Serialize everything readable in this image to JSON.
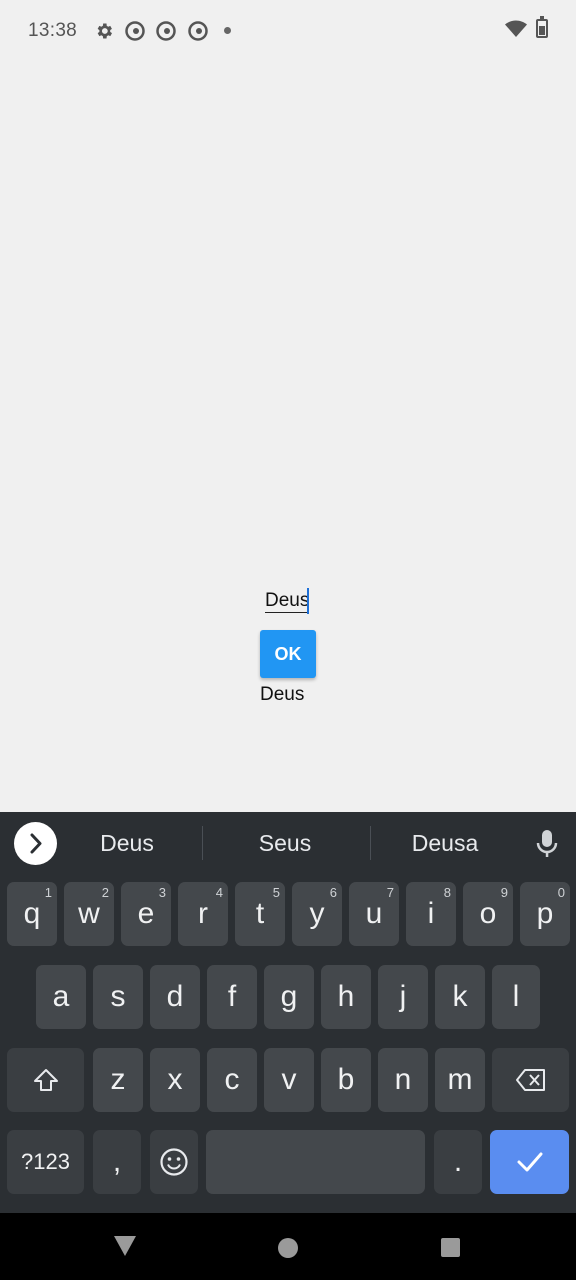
{
  "status_bar": {
    "time": "13:38",
    "icons": [
      "settings-gear-icon",
      "app-notification-icon",
      "app-notification-icon",
      "app-notification-icon",
      "more-dot-icon",
      "wifi-icon",
      "battery-icon"
    ]
  },
  "app": {
    "text_field_value": "Deus",
    "ok_button_label": "OK",
    "result_text": "Deus",
    "accent_color": "#2196f3"
  },
  "keyboard": {
    "suggestions": [
      "Deus",
      "Seus",
      "Deusa"
    ],
    "row1": [
      {
        "label": "q",
        "hint": "1"
      },
      {
        "label": "w",
        "hint": "2"
      },
      {
        "label": "e",
        "hint": "3"
      },
      {
        "label": "r",
        "hint": "4"
      },
      {
        "label": "t",
        "hint": "5"
      },
      {
        "label": "y",
        "hint": "6"
      },
      {
        "label": "u",
        "hint": "7"
      },
      {
        "label": "i",
        "hint": "8"
      },
      {
        "label": "o",
        "hint": "9"
      },
      {
        "label": "p",
        "hint": "0"
      }
    ],
    "row2": [
      "a",
      "s",
      "d",
      "f",
      "g",
      "h",
      "j",
      "k",
      "l"
    ],
    "row3": [
      "z",
      "x",
      "c",
      "v",
      "b",
      "n",
      "m"
    ],
    "symbols_label": "?123",
    "comma_label": ",",
    "period_label": ".",
    "enter_color": "#5a8df0"
  }
}
